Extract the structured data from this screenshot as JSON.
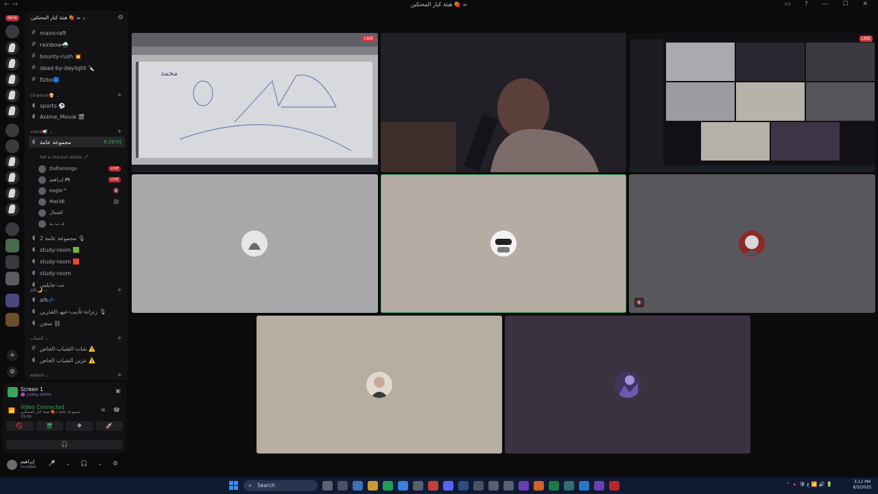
{
  "window": {
    "title": "هيئة كبار المحتكين 🍓 ☕",
    "nav": "← →",
    "controls": "▭ ? — ☐ ✕"
  },
  "rail": {
    "new_badge": "NEW"
  },
  "guild": {
    "name": "هيئة كبار المحتكين 🍓 ☕ ⌄",
    "gear_icon": "⚙"
  },
  "text_channels": [
    {
      "name": "maincraft"
    },
    {
      "name": "rainbow🌨️"
    },
    {
      "name": "bounty-rush 💥"
    },
    {
      "name": "dead-by-daylight 🔪"
    },
    {
      "name": "fizbo🔵"
    }
  ],
  "categories": {
    "cinemas": "cinemas🍿 ⌄",
    "voice": "voice📢 ⌄",
    "afk": "afk🌙 ⌄",
    "shabab": "الشباب ⌄",
    "admin": "admin ⌄"
  },
  "cinema_channels": [
    {
      "name": "sports ⚽"
    },
    {
      "name": "Anime_Movie 🎬"
    }
  ],
  "voice_channel": {
    "name": "مجموعة عامة",
    "time": "8:29:01",
    "status": "Set a channel status 🖊",
    "users": [
      {
        "name": "Doflamingo",
        "live": "LIVE"
      },
      {
        "name": "إبراهيم 🎮",
        "live": "LIVE"
      },
      {
        "name": "eagle™",
        "icon": "🔇"
      },
      {
        "name": "Mat3B",
        "icon": "🎥"
      },
      {
        "name": "الجمال"
      },
      {
        "name": "عـ ب ـد"
      }
    ]
  },
  "voice_channels_more": [
    {
      "name": "2 مجموعة عامة 🎙"
    },
    {
      "name": "study-room 🟩"
    },
    {
      "name": "study-room 🟥"
    },
    {
      "name": "study-room"
    },
    {
      "name": "تت-جايلس"
    }
  ],
  "afk_channels": [
    {
      "name": "afk💤"
    },
    {
      "name": "زنزانة-تأديب-غيهـ-القذرين 🎙"
    },
    {
      "name": "سجن ⛓"
    }
  ],
  "shabab_channels": [
    {
      "name": "شات-الشباب-الخاص ⚠️"
    },
    {
      "name": "عرين الشباب الخاص ⚠️"
    }
  ],
  "panel": {
    "screen_title": "Screen 1",
    "screen_sub": "🟣 1080p 60FPS",
    "video_connected": "Video Connected",
    "connection_sub": "مجموعة عامة / 🍓 هيئة كبار المحتكين",
    "connection_time": "23:00",
    "controls": [
      "🚫",
      "🖥",
      "✥",
      "🚀"
    ],
    "headphones": "🎧"
  },
  "userbar": {
    "name": "إبراهيم",
    "status": "Invisible",
    "buttons": "🎤 ⌄ 🎧 ⌄ ⚙"
  },
  "stage": {
    "live_label": "LIVE",
    "drawing_text": "محمد",
    "mute_badge": "🔇"
  },
  "taskbar": {
    "search_label": "Search",
    "tray": "⌃ 🔺 🛡 ع 📶 🔊 🔋",
    "time": "3:12 PM",
    "date": "8/5/2025"
  },
  "colors": {
    "accent_green": "#3ba55d",
    "live_red": "#d23a41",
    "taskbar": "#101a33"
  }
}
